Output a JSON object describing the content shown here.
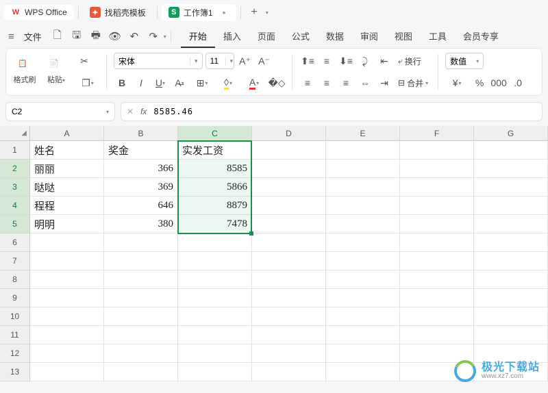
{
  "titlebar": {
    "app_name": "WPS Office",
    "tab_template": "找稻壳模板",
    "tab_workbook": "工作簿1",
    "plus": "+",
    "dots": "•"
  },
  "menubar": {
    "file": "文件",
    "tabs": {
      "start": "开始",
      "insert": "插入",
      "page": "页面",
      "formula": "公式",
      "data": "数据",
      "review": "审阅",
      "view": "视图",
      "tools": "工具",
      "member": "会员专享"
    }
  },
  "ribbon": {
    "format_brush": "格式刷",
    "paste": "粘贴",
    "font_name": "宋体",
    "font_size": "11",
    "wrap_text": "换行",
    "merge": "合并",
    "number_format": "数值",
    "currency": "¥",
    "percent": "%"
  },
  "formula_bar": {
    "cell_ref": "C2",
    "fx": "fx",
    "value": "8585.46"
  },
  "columns": [
    "A",
    "B",
    "C",
    "D",
    "E",
    "F",
    "G"
  ],
  "rows": [
    "1",
    "2",
    "3",
    "4",
    "5",
    "6",
    "7",
    "8",
    "9",
    "10",
    "11",
    "12",
    "13"
  ],
  "headers": {
    "name": "姓名",
    "bonus": "奖金",
    "salary": "实发工资"
  },
  "data_rows": [
    {
      "name": "丽丽",
      "bonus": "366",
      "salary": "8585"
    },
    {
      "name": "哒哒",
      "bonus": "369",
      "salary": "5866"
    },
    {
      "name": "程程",
      "bonus": "646",
      "salary": "8879"
    },
    {
      "name": "明明",
      "bonus": "380",
      "salary": "7478"
    }
  ],
  "watermark": {
    "cn": "极光下载站",
    "url": "www.xz7.com"
  }
}
